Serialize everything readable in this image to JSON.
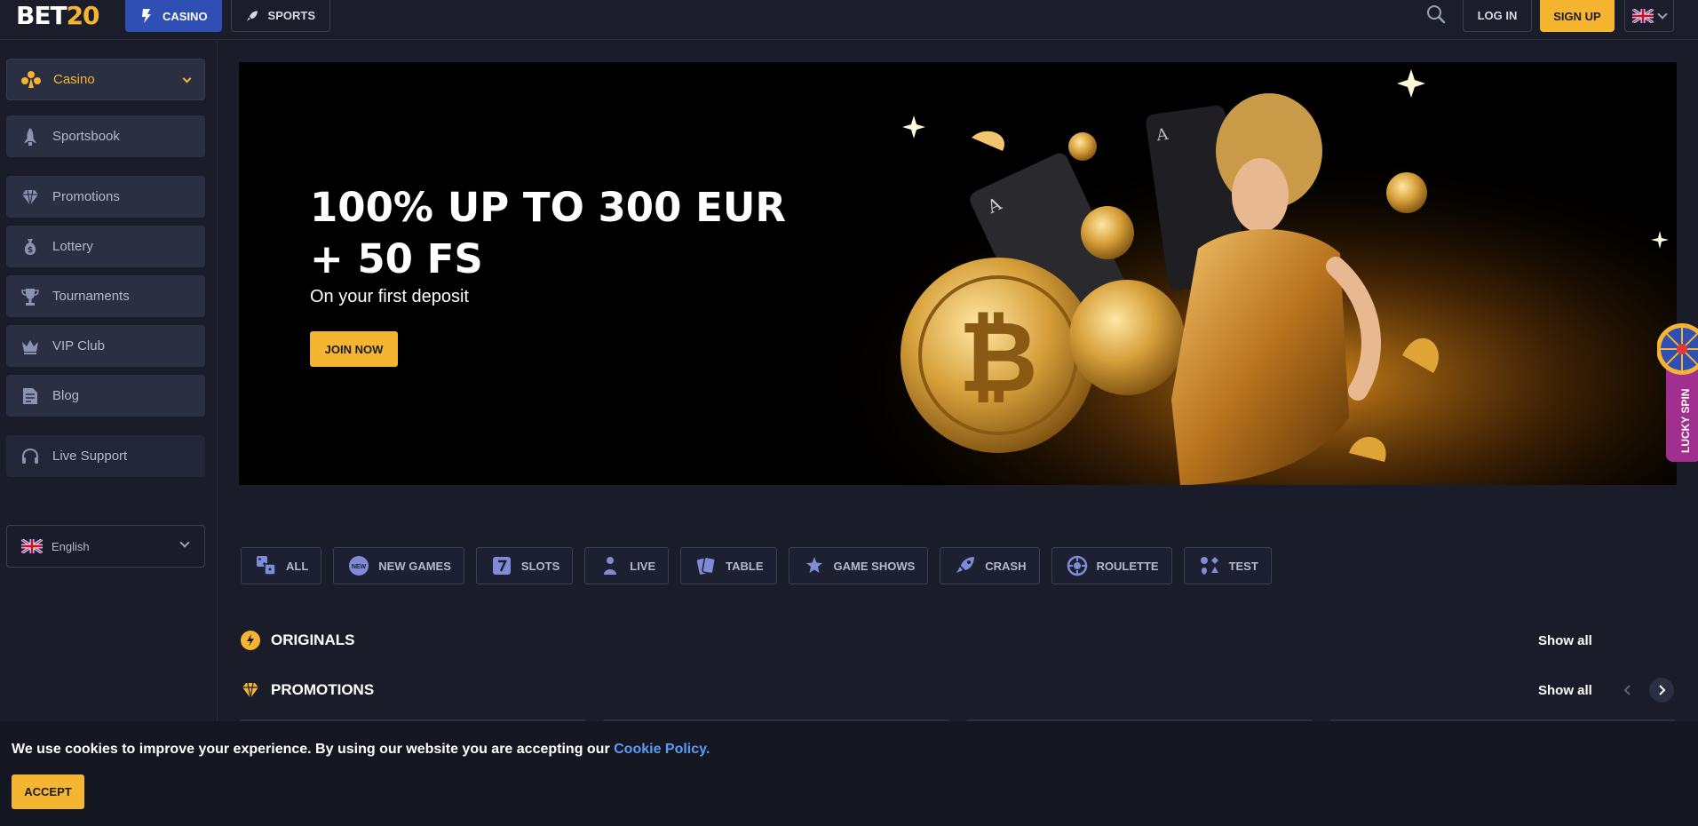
{
  "header": {
    "logo_main": "BET",
    "logo_accent": "20",
    "nav": {
      "casino": "CASINO",
      "sports": "SPORTS"
    },
    "login": "LOG IN",
    "signup": "SIGN UP"
  },
  "sidebar": {
    "items": [
      {
        "label": "Casino",
        "icon": "casino-icon"
      },
      {
        "label": "Sportsbook",
        "icon": "rocket-icon"
      },
      {
        "label": "Promotions",
        "icon": "diamond-icon"
      },
      {
        "label": "Lottery",
        "icon": "money-bag-icon"
      },
      {
        "label": "Tournaments",
        "icon": "trophy-icon"
      },
      {
        "label": "VIP Club",
        "icon": "crown-icon"
      },
      {
        "label": "Blog",
        "icon": "document-icon"
      },
      {
        "label": "Live Support",
        "icon": "headset-icon"
      }
    ],
    "language": "English"
  },
  "banner": {
    "title_line1": "100% UP TO 300 EUR",
    "title_line2": "+ 50 FS",
    "subtitle": "On your first deposit",
    "cta": "JOIN NOW"
  },
  "lucky_spin": "LUCKY SPIN",
  "categories": [
    {
      "label": "ALL",
      "icon": "dice-icon"
    },
    {
      "label": "NEW GAMES",
      "icon": "new-badge-icon",
      "badge": "NEW"
    },
    {
      "label": "SLOTS",
      "icon": "slot-seven-icon"
    },
    {
      "label": "LIVE",
      "icon": "dealer-icon"
    },
    {
      "label": "TABLE",
      "icon": "cards-icon"
    },
    {
      "label": "GAME SHOWS",
      "icon": "star-hand-icon"
    },
    {
      "label": "CRASH",
      "icon": "rocket-icon"
    },
    {
      "label": "ROULETTE",
      "icon": "roulette-icon"
    },
    {
      "label": "TEST",
      "icon": "suits-icon"
    }
  ],
  "sections": [
    {
      "title": "ORIGINALS",
      "show_all": "Show all"
    },
    {
      "title": "PROMOTIONS",
      "show_all": "Show all"
    }
  ],
  "cookie": {
    "text": "We use cookies to improve your experience. By using our website you are accepting our ",
    "link": "Cookie Policy.",
    "accept": "ACCEPT"
  },
  "colors": {
    "accent": "#f6b531",
    "primary": "#2f4fb5",
    "background": "#1a1d29",
    "panel": "#2a2f42",
    "link": "#5a9cf5"
  }
}
